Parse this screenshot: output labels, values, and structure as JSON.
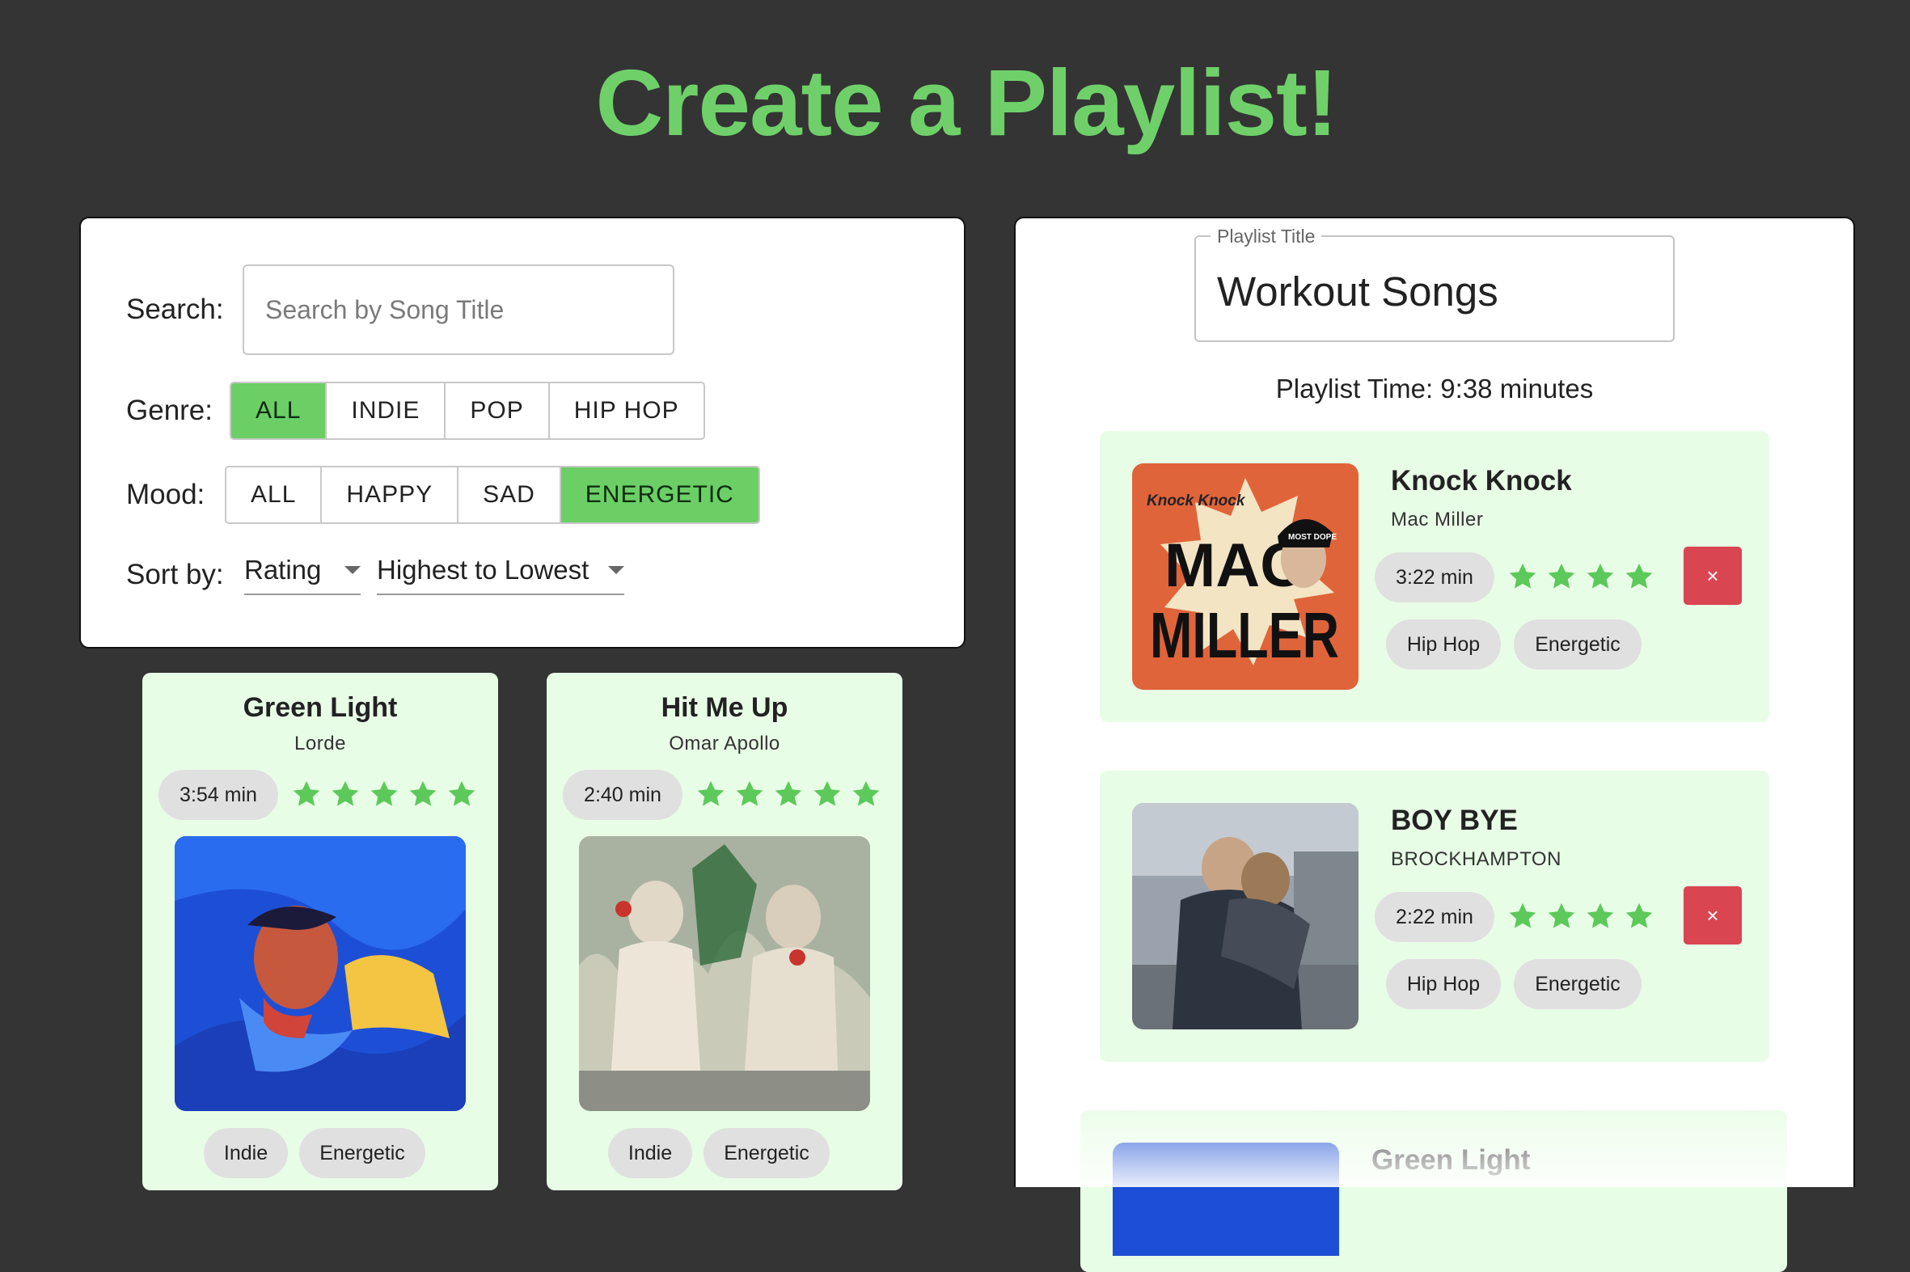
{
  "page": {
    "title": "Create a Playlist!"
  },
  "colors": {
    "background": "#343434",
    "accent": "#6fd06a",
    "card": "#e8fde6",
    "remove": "#d94550"
  },
  "filters": {
    "search_label": "Search:",
    "search_placeholder": "Search by Song Title",
    "genre_label": "Genre:",
    "genres": [
      "ALL",
      "INDIE",
      "POP",
      "HIP HOP"
    ],
    "genre_selected": "ALL",
    "mood_label": "Mood:",
    "moods": [
      "ALL",
      "HAPPY",
      "SAD",
      "ENERGETIC"
    ],
    "mood_selected": "ENERGETIC",
    "sort_label": "Sort by:",
    "sort_field": "Rating",
    "sort_order": "Highest to Lowest"
  },
  "songs": [
    {
      "title": "Green Light",
      "artist": "Lorde",
      "duration": "3:54 min",
      "rating": 5,
      "tags": [
        "Indie",
        "Energetic"
      ]
    },
    {
      "title": "Hit Me Up",
      "artist": "Omar Apollo",
      "duration": "2:40 min",
      "rating": 5,
      "tags": [
        "Indie",
        "Energetic"
      ]
    }
  ],
  "playlist": {
    "title_label": "Playlist Title",
    "title_value": "Workout Songs",
    "time_text": "Playlist Time: 9:38 minutes",
    "remove_label": "×",
    "items": [
      {
        "title": "Knock Knock",
        "artist": "Mac Miller",
        "duration": "3:22 min",
        "rating": 4,
        "tags": [
          "Hip Hop",
          "Energetic"
        ],
        "art_text": [
          "Knock Knock",
          "MAC",
          "MILLER",
          "MOST DOPE"
        ]
      },
      {
        "title": "BOY BYE",
        "artist": "BROCKHAMPTON",
        "duration": "2:22 min",
        "rating": 4,
        "tags": [
          "Hip Hop",
          "Energetic"
        ]
      },
      {
        "title": "Green Light"
      }
    ]
  }
}
